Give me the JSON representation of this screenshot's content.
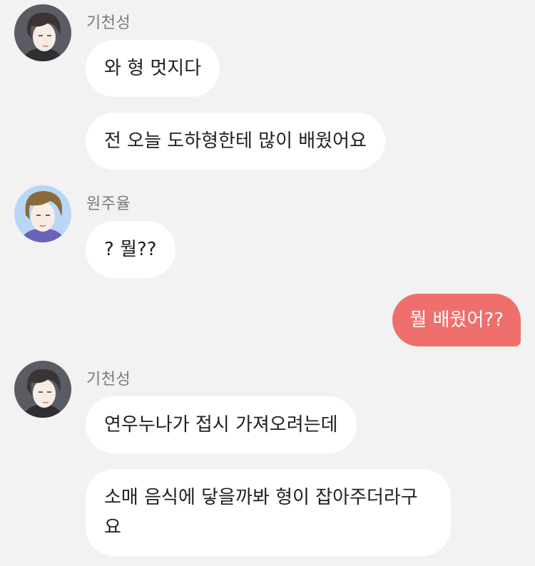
{
  "chat": {
    "groups": [
      {
        "sender": "기천성",
        "avatar_icon": "young-man-dark-hair-avatar-icon",
        "messages": [
          "와 형 멋지다",
          "전 오늘 도하형한테 많이 배웠어요"
        ]
      },
      {
        "sender": "원주율",
        "avatar_icon": "young-man-brown-hair-avatar-icon",
        "messages": [
          "? 뭘??"
        ]
      },
      {
        "sender": "",
        "mine": true,
        "messages": [
          "뭘 배웠어??"
        ]
      },
      {
        "sender": "기천성",
        "avatar_icon": "young-man-dark-hair-avatar-icon",
        "messages": [
          "연우누나가 접시 가져오려는데",
          "소매 음식에 닿을까봐 형이 잡아주더라구\n요"
        ]
      }
    ]
  },
  "colors": {
    "background": "#f2f2f2",
    "other_bubble": "#ffffff",
    "my_bubble": "#ef6f6c",
    "sender_text": "#7a7a7a"
  }
}
